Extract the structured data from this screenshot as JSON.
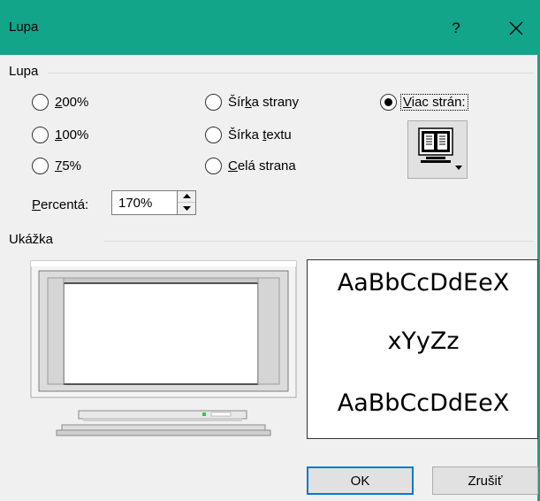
{
  "window": {
    "title": "Lupa",
    "help_label": "?",
    "titlebar_color": "#12a589",
    "close_icon": "close-icon"
  },
  "zoom_group": {
    "label": "Lupa",
    "options": [
      {
        "pre": "",
        "key": "2",
        "post": "00%",
        "checked": false
      },
      {
        "pre": "",
        "key": "1",
        "post": "00%",
        "checked": false
      },
      {
        "pre": "",
        "key": "7",
        "post": "5%",
        "checked": false
      },
      {
        "pre": "Šír",
        "key": "k",
        "post": "a strany",
        "checked": false
      },
      {
        "pre": "Šírka ",
        "key": "t",
        "post": "extu",
        "checked": false
      },
      {
        "pre": "",
        "key": "C",
        "post": "elá strana",
        "checked": false
      },
      {
        "pre": "",
        "key": "V",
        "post": "iac strán:",
        "checked": true
      }
    ],
    "multi_page_icon": "multiple-pages-monitor-icon"
  },
  "percent": {
    "pre": "",
    "key": "P",
    "post": "ercentá:",
    "value": "170%",
    "up_icon": "spin-up-icon",
    "down_icon": "spin-down-icon"
  },
  "preview_group": {
    "label": "Ukážka",
    "monitor_icon": "monitor-preview-icon",
    "sample_lines": [
      "AaBbCcDdEeX",
      "xYyZz",
      "AaBbCcDdEeX"
    ]
  },
  "buttons": {
    "ok": "OK",
    "cancel": "Zrušiť"
  },
  "colors": {
    "accent": "#12a589",
    "focus": "#0078d7",
    "dialog_bg": "#f0f0f0"
  }
}
